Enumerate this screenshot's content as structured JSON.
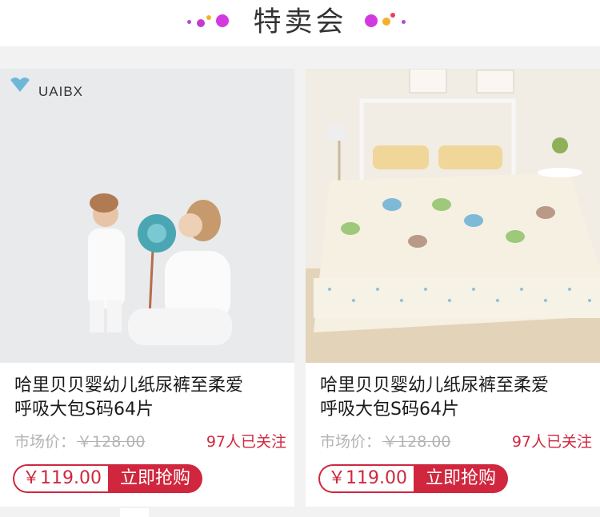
{
  "header": {
    "title": "特卖会"
  },
  "colors": {
    "accent": "#d0273e",
    "title_text": "#333333",
    "muted": "#b3b3b3",
    "card_bg": "#ffffff",
    "page_bg": "#f2f2f2"
  },
  "products": [
    {
      "brand": "UAIBX",
      "title_line1": "哈里贝贝婴幼儿纸尿裤至柔爱",
      "title_line2": "呼吸大包S码64片",
      "market_label": "市场价：",
      "market_price": "￥128.00",
      "followers": "97人已关注",
      "price": "￥119.00",
      "buy_label": "立即抢购",
      "image_icon": "family-pajamas-photo"
    },
    {
      "title_line1": "哈里贝贝婴幼儿纸尿裤至柔爱",
      "title_line2": "呼吸大包S码64片",
      "market_label": "市场价：",
      "market_price": "￥128.00",
      "followers": "97人已关注",
      "price": "￥119.00",
      "buy_label": "立即抢购",
      "image_icon": "bedding-set-photo"
    }
  ]
}
